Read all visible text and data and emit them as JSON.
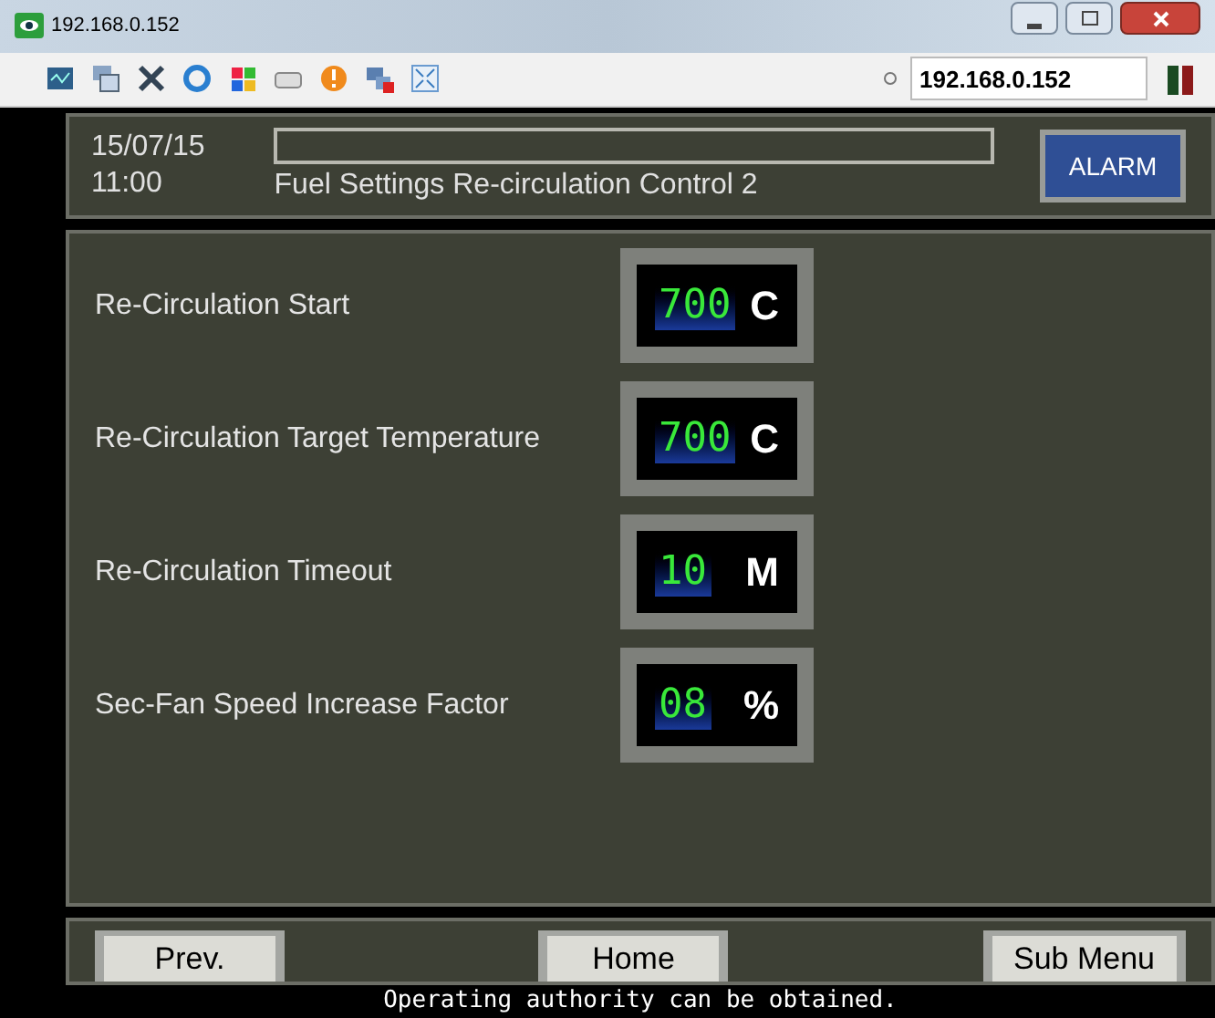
{
  "window": {
    "title": "192.168.0.152",
    "address": "192.168.0.152"
  },
  "header": {
    "date": "15/07/15",
    "time": "11:00",
    "screen_title": "Fuel Settings Re-circulation Control 2",
    "alarm_button": "ALARM"
  },
  "settings": [
    {
      "label": "Re-Circulation Start",
      "value": "700",
      "unit": "C"
    },
    {
      "label": "Re-Circulation Target Temperature",
      "value": "700",
      "unit": "C"
    },
    {
      "label": "Re-Circulation Timeout",
      "value": "10",
      "unit": "M"
    },
    {
      "label": "Sec-Fan Speed Increase Factor",
      "value": "08",
      "unit": "%"
    }
  ],
  "nav_buttons": [
    "Prev.",
    "Home",
    "Sub Menu"
  ],
  "status_bar": "Operating authority can be obtained."
}
